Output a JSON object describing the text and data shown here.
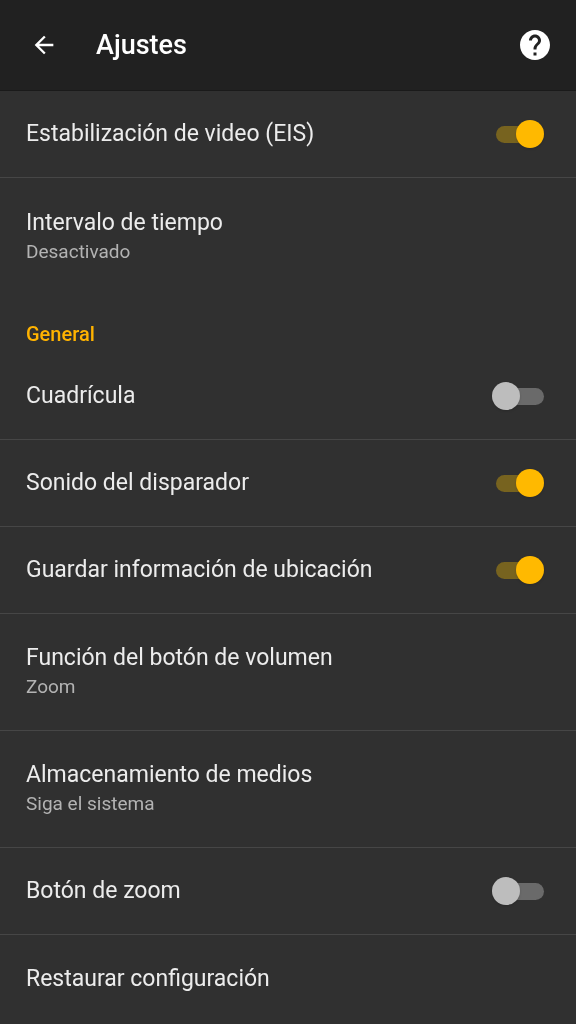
{
  "app_bar": {
    "title": "Ajustes"
  },
  "items": [
    {
      "kind": "toggle",
      "label": "Estabilización de video (EIS)",
      "on": true
    },
    {
      "kind": "subtitle",
      "label": "Intervalo de tiempo",
      "summary": "Desactivado"
    },
    {
      "kind": "header",
      "label": "General"
    },
    {
      "kind": "toggle",
      "label": "Cuadrícula",
      "on": false
    },
    {
      "kind": "toggle",
      "label": "Sonido del disparador",
      "on": true
    },
    {
      "kind": "toggle",
      "label": "Guardar información de ubicación",
      "on": true
    },
    {
      "kind": "subtitle",
      "label": "Función del botón de volumen",
      "summary": "Zoom"
    },
    {
      "kind": "subtitle",
      "label": "Almacenamiento de medios",
      "summary": "Siga el sistema"
    },
    {
      "kind": "toggle",
      "label": "Botón de zoom",
      "on": false
    },
    {
      "kind": "plain",
      "label": "Restaurar configuración"
    }
  ]
}
